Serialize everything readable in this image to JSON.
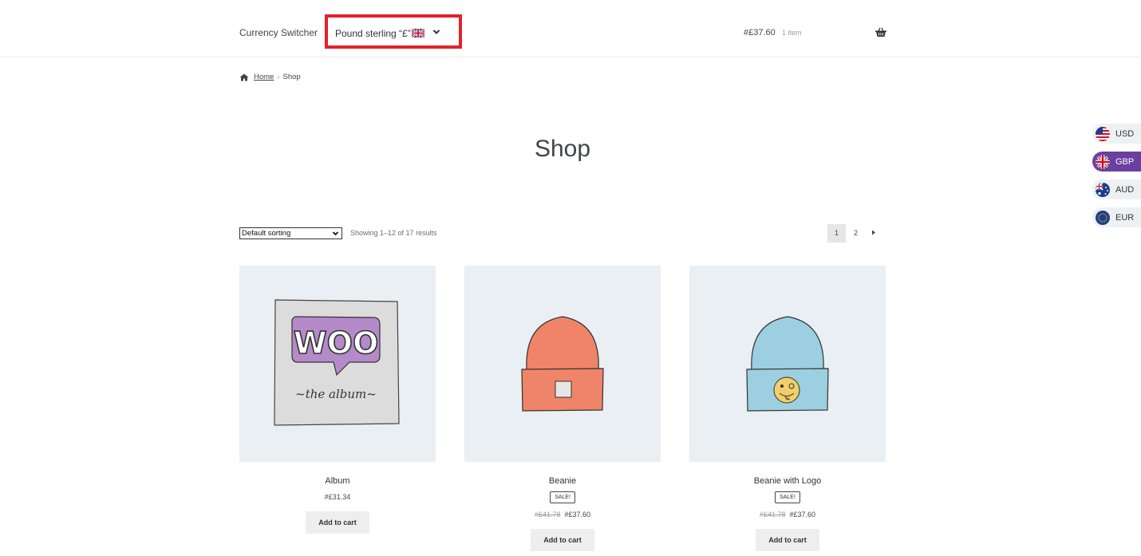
{
  "header": {
    "site_title": "Currency Switcher",
    "currency_select_value": "Pound sterling “£”",
    "cart_amount": "#£37.60",
    "cart_count": "1 item"
  },
  "breadcrumb": {
    "home": "Home",
    "separator": "›",
    "current": "Shop"
  },
  "page_title": "Shop",
  "toolbar": {
    "sort_value": "Default sorting",
    "results_text": "Showing 1–12 of 17 results",
    "pages": [
      "1",
      "2"
    ],
    "next_icon": "triangle-right-icon"
  },
  "products": [
    {
      "name": "Album",
      "price": "#£31.34",
      "button": "Add to cart"
    },
    {
      "name": "Beanie",
      "sale": "SALE!",
      "old_price": "#£41.78",
      "price": "#£37.60",
      "button": "Add to cart"
    },
    {
      "name": "Beanie with Logo",
      "sale": "SALE!",
      "old_price": "#£41.78",
      "price": "#£37.60",
      "button": "Add to cart"
    }
  ],
  "currency_sidebar": [
    {
      "code": "USD",
      "flag": "us-flag-icon"
    },
    {
      "code": "GBP",
      "flag": "uk-flag-icon",
      "active": true
    },
    {
      "code": "AUD",
      "flag": "au-flag-icon"
    },
    {
      "code": "EUR",
      "flag": "eu-flag-icon"
    }
  ],
  "colors": {
    "highlight_border": "#e3202b",
    "active_currency": "#6b3fa0",
    "product_bg": "#e9eff3"
  }
}
